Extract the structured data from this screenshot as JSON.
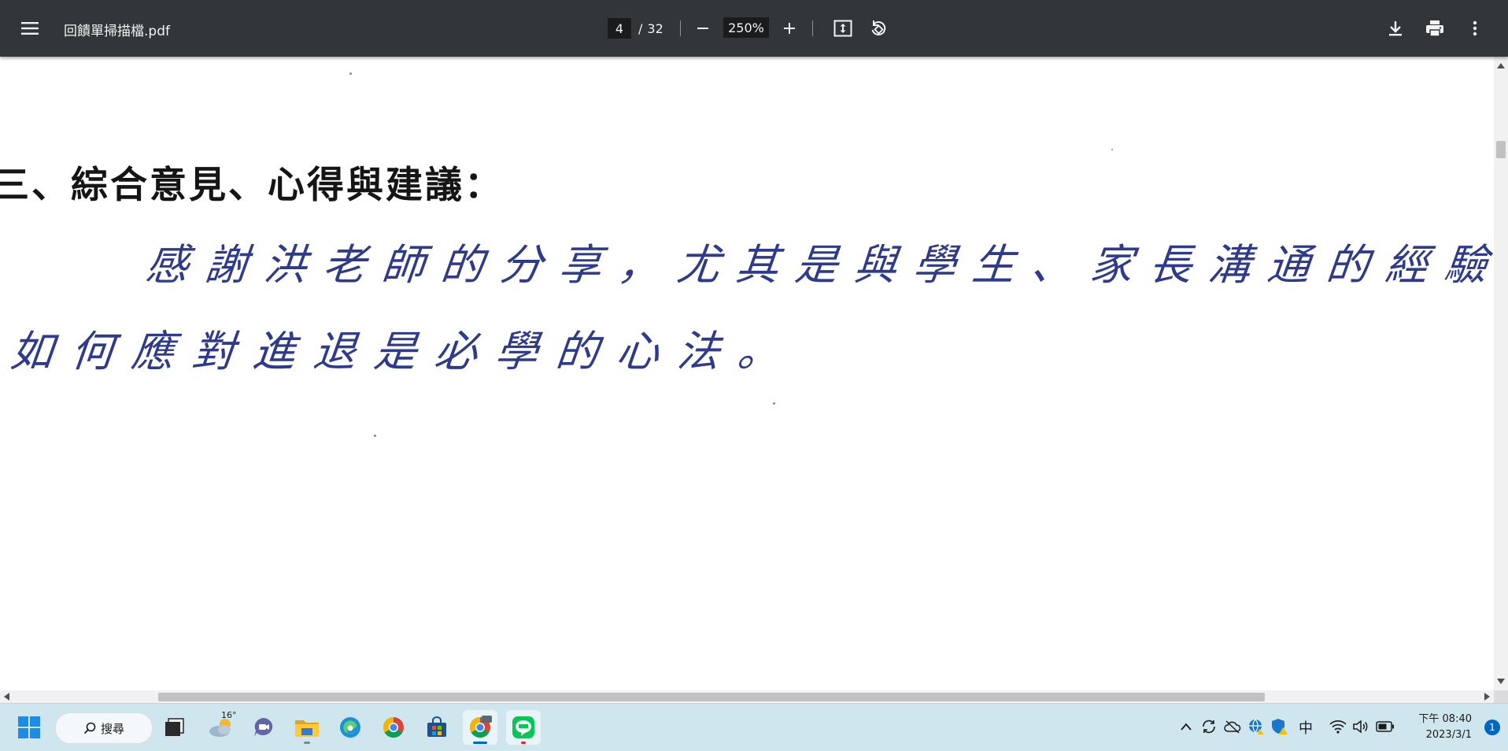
{
  "toolbar": {
    "file_name": "回饋單掃描檔.pdf",
    "page_current": "4",
    "page_separator": "/",
    "page_total": "32",
    "zoom": "250%",
    "menu_icon": "hamburger-menu-icon",
    "zoom_out_icon": "minus-icon",
    "zoom_in_icon": "plus-icon",
    "fit_icon": "fit-to-page-icon",
    "rotate_icon": "rotate-counterclockwise-icon",
    "download_icon": "download-icon",
    "print_icon": "print-icon",
    "more_icon": "more-vertical-icon"
  },
  "document": {
    "section_heading": "三、綜合意見、心得與建議：",
    "handwriting_line_1": "感謝洪老師的分享，尤其是與學生、家長溝通的經驗，",
    "handwriting_line_2": "如何應對進退是必學的心法。"
  },
  "taskbar": {
    "search_label": "搜尋",
    "weather_temp": "16°",
    "ime_indicator": "中",
    "time": "下午 08:40",
    "date": "2023/3/1",
    "notification_count": "1"
  },
  "colors": {
    "toolbar_bg": "#323639",
    "handwriting_ink": "#2e3a8c",
    "taskbar_bg": "#cfe6ef",
    "accent": "#0067c0"
  }
}
